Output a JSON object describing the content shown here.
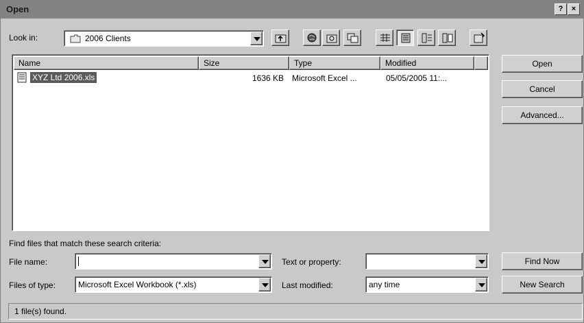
{
  "window": {
    "title": "Open",
    "help_label": "?",
    "close_label": "×"
  },
  "lookin": {
    "label": "Look in:",
    "value": "2006 Clients"
  },
  "toolbar": {
    "icons": [
      "up-folder-icon",
      "search-web-icon",
      "new-folder-icon",
      "copy-folder-icon",
      "list-view-icon",
      "details-view-icon",
      "properties-view-icon",
      "preview-view-icon",
      "commands-icon"
    ]
  },
  "list": {
    "columns": [
      "Name",
      "Size",
      "Type",
      "Modified"
    ],
    "rows": [
      {
        "name": "XYZ Ltd 2006.xls",
        "size": "1636 KB",
        "type": "Microsoft Excel ...",
        "modified": "05/05/2005 11:..."
      }
    ]
  },
  "buttons": {
    "open": "Open",
    "cancel": "Cancel",
    "advanced": "Advanced...",
    "find_now": "Find Now",
    "new_search": "New Search"
  },
  "search": {
    "heading": "Find files that match these search criteria:",
    "filename_label": "File name:",
    "filename_value": "",
    "text_label": "Text or property:",
    "text_value": "",
    "type_label": "Files of type:",
    "type_value": "Microsoft Excel Workbook (*.xls)",
    "modified_label": "Last modified:",
    "modified_value": "any time"
  },
  "status": {
    "text": "1 file(s) found."
  }
}
